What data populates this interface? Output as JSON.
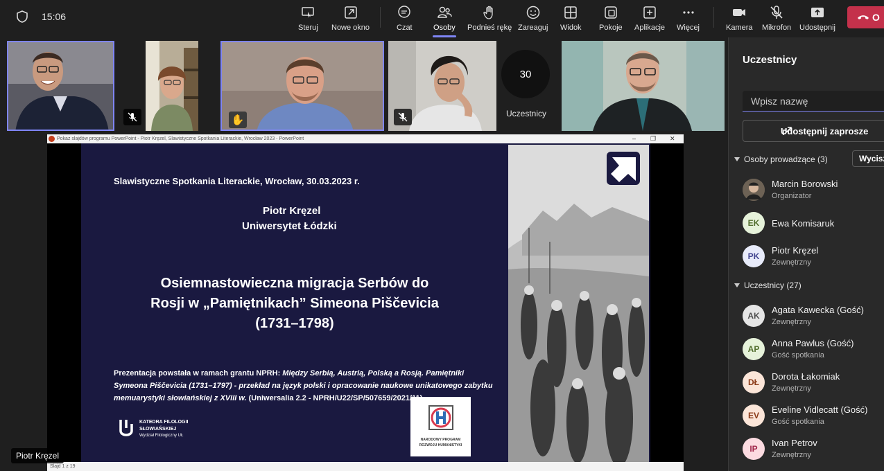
{
  "status": {
    "time": "15:06"
  },
  "toolbar": {
    "items": [
      {
        "label": "Steruj",
        "icon": "share-control-icon"
      },
      {
        "label": "Nowe okno",
        "icon": "new-window-icon"
      },
      {
        "label": "Czat",
        "icon": "chat-icon"
      },
      {
        "label": "Osoby",
        "icon": "people-icon"
      },
      {
        "label": "Podnieś rękę",
        "icon": "raise-hand-icon"
      },
      {
        "label": "Zareaguj",
        "icon": "react-icon"
      },
      {
        "label": "Widok",
        "icon": "view-icon"
      },
      {
        "label": "Pokoje",
        "icon": "rooms-icon"
      },
      {
        "label": "Aplikacje",
        "icon": "apps-icon"
      },
      {
        "label": "Więcej",
        "icon": "more-icon"
      },
      {
        "label": "Kamera",
        "icon": "camera-icon"
      },
      {
        "label": "Mikrofon",
        "icon": "mic-off-icon"
      },
      {
        "label": "Udostępnij",
        "icon": "share-icon"
      }
    ],
    "leave_label": "O"
  },
  "video": {
    "counter_value": "30",
    "counter_label": "Uczestnicy"
  },
  "share": {
    "window_title": "Pokaz slajdów programu PowerPoint  -  Piotr Kręzel, Slawistyczne Spotkania Literackie, Wrocław 2023 - PowerPoint",
    "slide_counter": "Slajd 1 z 19",
    "presenter_tag": "Piotr Kręzel"
  },
  "slide": {
    "event": "Slawistyczne Spotkania Literackie, Wrocław, 30.03.2023 r.",
    "author": "Piotr Kręzel",
    "affiliation": "Uniwersytet Łódzki",
    "title_line1": "Osiemnastowieczna migracja Serbów do",
    "title_line2": "Rosji w „Pamiętnikach” Simeona Piščevicia",
    "title_line3": "(1731–1798)",
    "grant_prefix": "Prezentacja powstała w ramach grantu NPRH: ",
    "grant_italic": "Między Serbią, Austrią, Polską a Rosją. Pamiętniki Symeona Piščevicia (1731–1797) - przekład na język polski i opracowanie naukowe unikatowego zabytku memuarystyki słowiańskiej z XVIII w.",
    "grant_suffix": " (Uniwersalia 2.2 - NPRH/U22/SP/507659/2021/11)",
    "dept_line1": "KATEDRA FILOLOGII",
    "dept_line2": "SŁOWIAŃSKIEJ",
    "dept_line3": "Wydział Filologiczny UŁ",
    "nprh_line1": "NARODOWY PROGRAM",
    "nprh_line2": "ROZWOJU HUMANISTYKI"
  },
  "panel": {
    "title": "Uczestnicy",
    "search_placeholder": "Wpisz nazwę",
    "invite_label": "Udostępnij zaprosze",
    "organizers_header": "Osoby prowadzące (3)",
    "mute_all_label": "Wycisz",
    "attendees_header": "Uczestnicy (27)",
    "organizers": [
      {
        "initials": "",
        "name": "Marcin Borowski",
        "role": "Organizator"
      },
      {
        "initials": "EK",
        "name": "Ewa Komisaruk",
        "role": ""
      },
      {
        "initials": "PK",
        "name": "Piotr Kręzel",
        "role": "Zewnętrzny"
      }
    ],
    "attendees": [
      {
        "initials": "AK",
        "name": "Agata Kawecka (Gość)",
        "role": "Zewnętrzny"
      },
      {
        "initials": "AP",
        "name": "Anna Pawlus (Gość)",
        "role": "Gość spotkania"
      },
      {
        "initials": "DŁ",
        "name": "Dorota Łakomiak",
        "role": "Zewnętrzny"
      },
      {
        "initials": "EV",
        "name": "Eveline Vidlecatt (Gość)",
        "role": "Gość spotkania"
      },
      {
        "initials": "IP",
        "name": "Ivan Petrov",
        "role": "Zewnętrzny"
      }
    ]
  }
}
